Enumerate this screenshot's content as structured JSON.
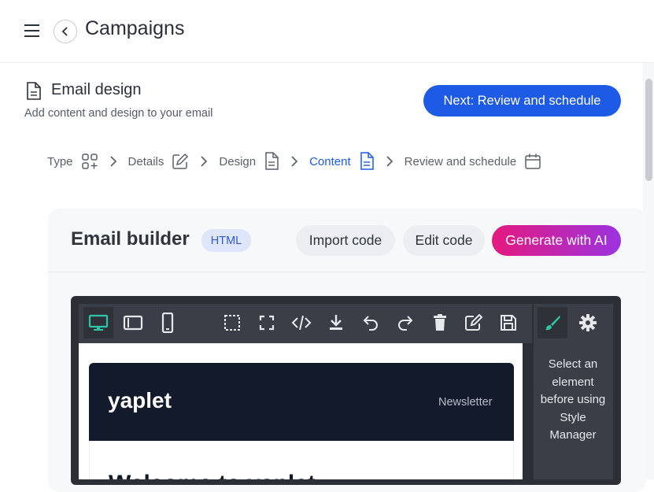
{
  "header": {
    "title": "Campaigns"
  },
  "section": {
    "title": "Email design",
    "subtitle": "Add content and design to your email",
    "next_label": "Next: Review and schedule"
  },
  "steps": [
    {
      "label": "Type",
      "icon": "grid-plus-icon",
      "active": false
    },
    {
      "label": "Details",
      "icon": "pencil-square-icon",
      "active": false
    },
    {
      "label": "Design",
      "icon": "document-icon",
      "active": false
    },
    {
      "label": "Content",
      "icon": "document-icon",
      "active": true
    },
    {
      "label": "Review and schedule",
      "icon": "calendar-icon",
      "active": false
    }
  ],
  "builder": {
    "title": "Email builder",
    "badge": "HTML",
    "import_label": "Import code",
    "edit_label": "Edit code",
    "ai_label": "Generate with AI"
  },
  "editor": {
    "toolbar": [
      "desktop-icon",
      "tablet-icon",
      "mobile-icon",
      "outline-icon",
      "fullscreen-icon",
      "code-icon",
      "download-icon",
      "undo-icon",
      "redo-icon",
      "trash-icon",
      "edit-icon",
      "save-icon",
      "brush-icon",
      "gear-icon"
    ],
    "panel_message": "Select an element before using Style Manager",
    "email": {
      "logo": "yaplet",
      "tag": "Newsletter",
      "heading": "Welcome to yaplet"
    }
  },
  "colors": {
    "primary": "#1d5ae6",
    "accent": "#2ec4a6",
    "dark": "#131a2b",
    "gradient_start": "#e5197f",
    "gradient_end": "#9b33e0"
  }
}
